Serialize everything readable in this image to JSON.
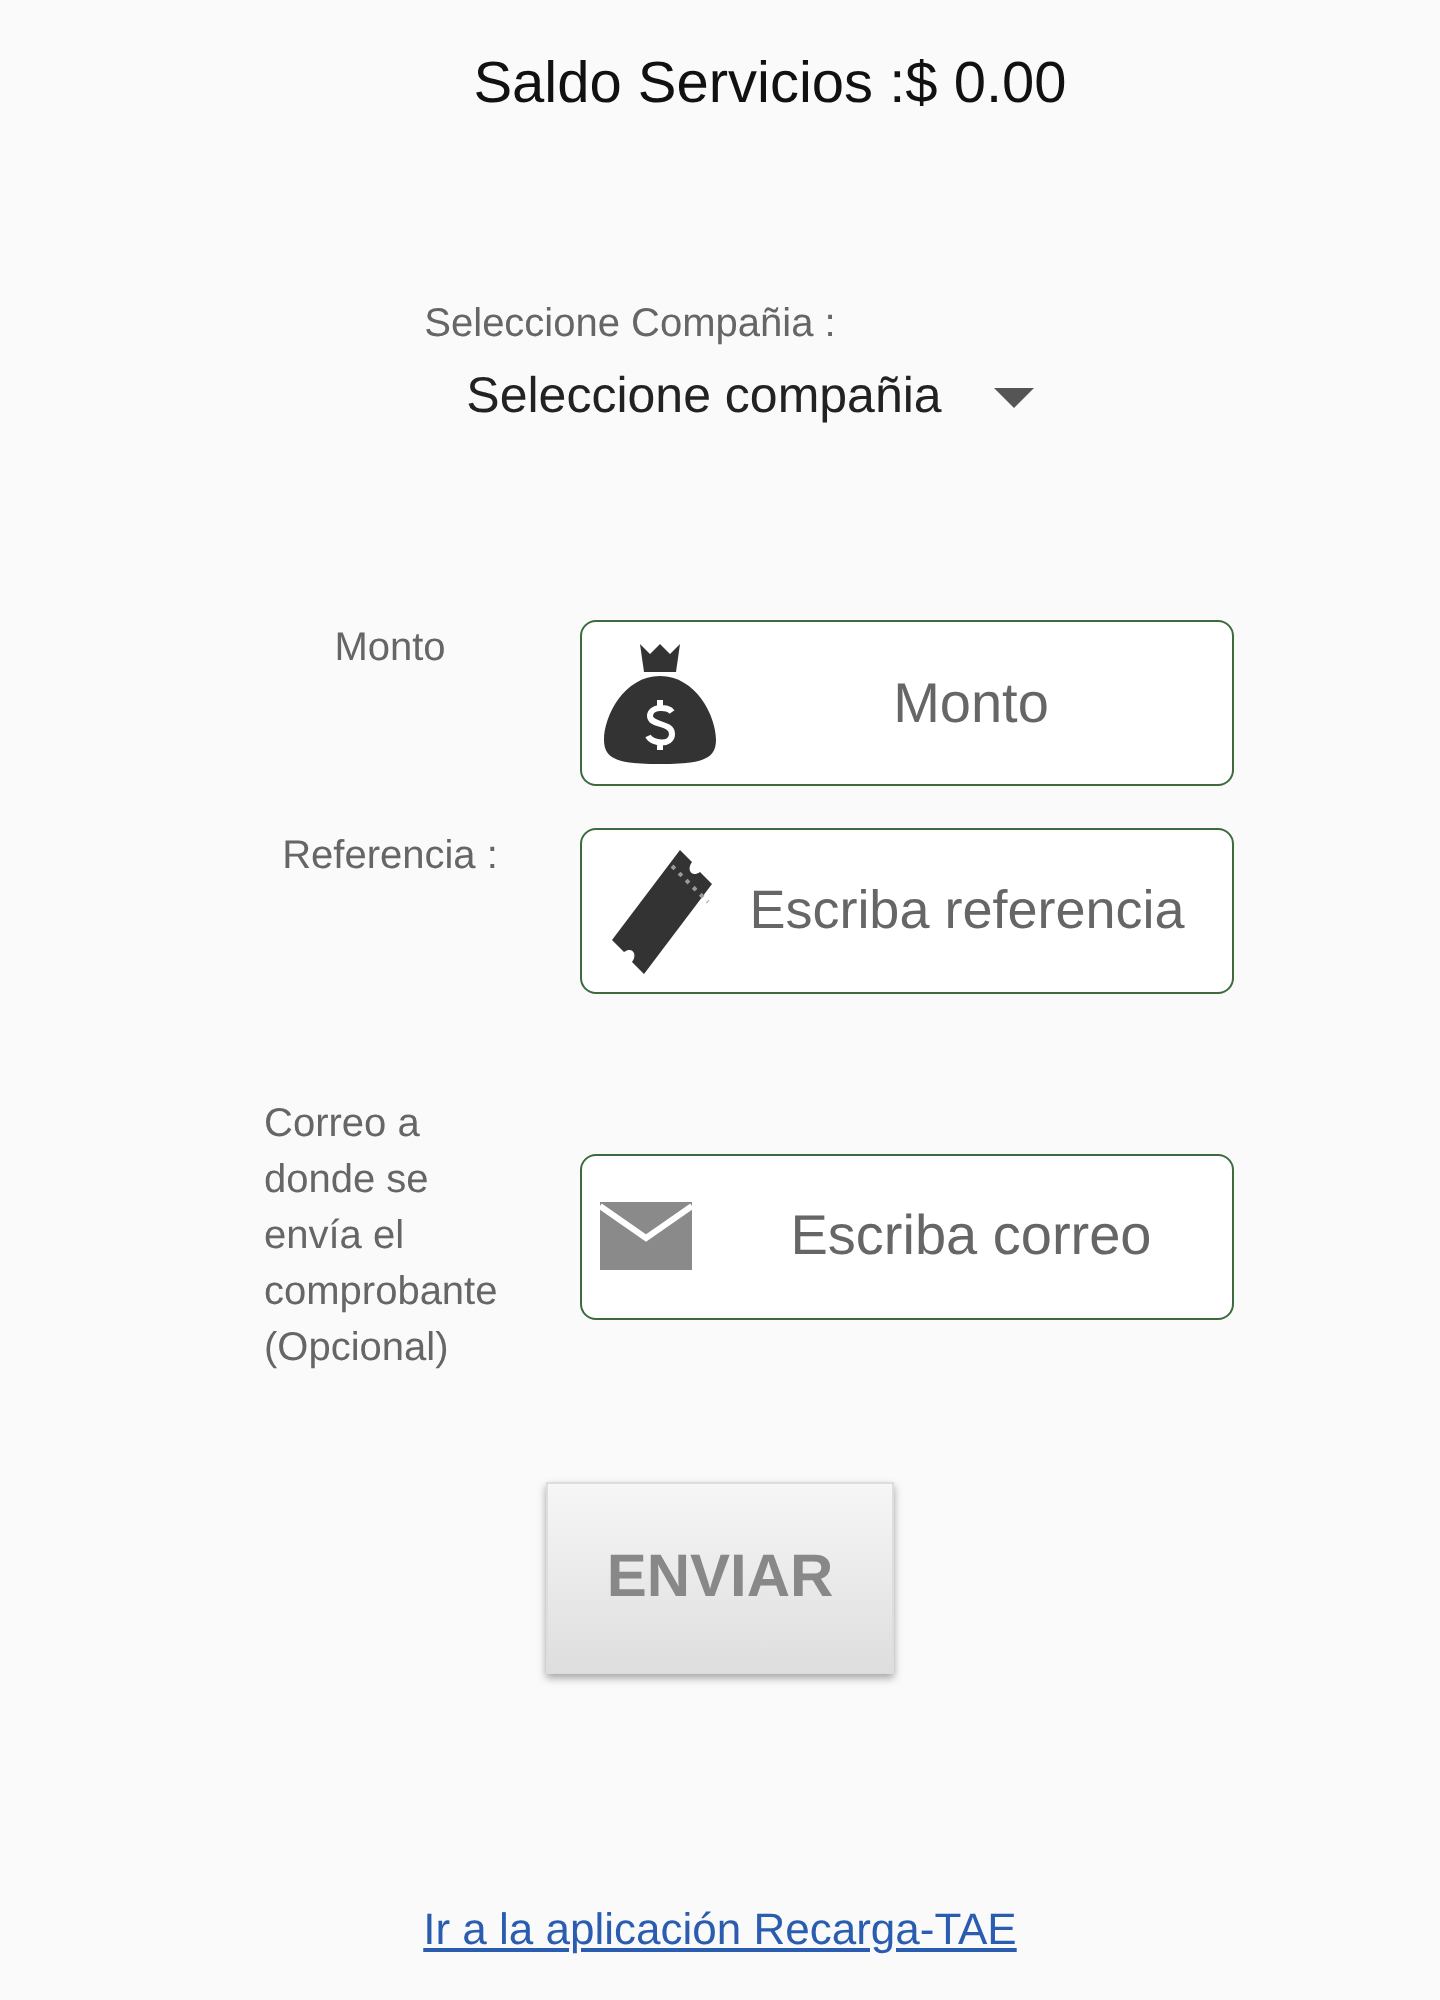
{
  "balance": {
    "text": "Saldo Servicios :$ 0.00"
  },
  "company": {
    "label": "Seleccione Compañia :",
    "value": "Seleccione compañia"
  },
  "fields": [
    {
      "label": "Monto",
      "placeholder": "Monto"
    },
    {
      "label": "Referencia :",
      "placeholder": "Escriba referencia"
    },
    {
      "label": "Correo a donde se envía el comprobante (Opcional)",
      "placeholder": "Escriba correo"
    }
  ],
  "submit": {
    "label": "ENVIAR",
    "disabled": true
  },
  "link": {
    "text": "Ir a la aplicación Recarga-TAE"
  }
}
